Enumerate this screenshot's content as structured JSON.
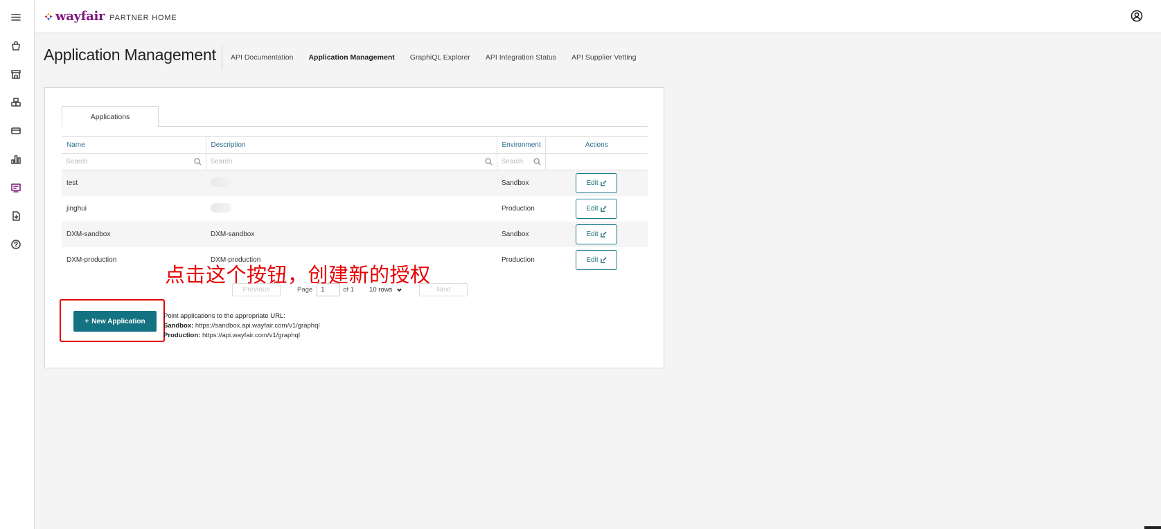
{
  "brand": {
    "word": "wayfair",
    "sub": "PARTNER HOME",
    "colors": {
      "brand_purple": "#7f187f",
      "teal": "#137382",
      "annotation_red": "#e60000"
    }
  },
  "rail": {
    "items": [
      {
        "icon": "menu-icon"
      },
      {
        "icon": "bag-icon"
      },
      {
        "icon": "store-icon"
      },
      {
        "icon": "boxes-icon"
      },
      {
        "icon": "card-icon"
      },
      {
        "icon": "bar-chart-icon"
      },
      {
        "icon": "developer-icon",
        "active": true
      },
      {
        "icon": "document-icon"
      },
      {
        "icon": "help-icon"
      }
    ]
  },
  "header": {
    "title": "Application Management",
    "nav": [
      {
        "label": "API Documentation",
        "active": false
      },
      {
        "label": "Application Management",
        "active": true
      },
      {
        "label": "GraphiQL Explorer",
        "active": false
      },
      {
        "label": "API Integration Status",
        "active": false
      },
      {
        "label": "API Supplier Vetting",
        "active": false
      }
    ]
  },
  "tabs": {
    "applications": "Applications"
  },
  "table": {
    "columns": [
      "Name",
      "Description",
      "Environment",
      "Actions"
    ],
    "search_placeholder": "Search",
    "edit_label": "Edit",
    "rows": [
      {
        "name": "test",
        "description": "",
        "environment": "Sandbox"
      },
      {
        "name": "jinghui",
        "description": "",
        "environment": "Production"
      },
      {
        "name": "DXM-sandbox",
        "description": "DXM-sandbox",
        "environment": "Sandbox"
      },
      {
        "name": "DXM-production",
        "description": "DXM-production",
        "environment": "Production"
      }
    ]
  },
  "pager": {
    "previous": "Previous",
    "page_label": "Page",
    "page_value": "1",
    "of_label": "of 1",
    "rows_label": "10 rows",
    "next": "Next"
  },
  "actions": {
    "new_application": "New Application",
    "plus": "+"
  },
  "urls": {
    "intro": "Point applications to the appropriate URL:",
    "sandbox_label": "Sandbox:",
    "sandbox_url": "https://sandbox.api.wayfair.com/v1/graphql",
    "production_label": "Production:",
    "production_url": "https://api.wayfair.com/v1/graphql"
  },
  "annotation": {
    "text": "点击这个按钮，创建新的授权"
  }
}
